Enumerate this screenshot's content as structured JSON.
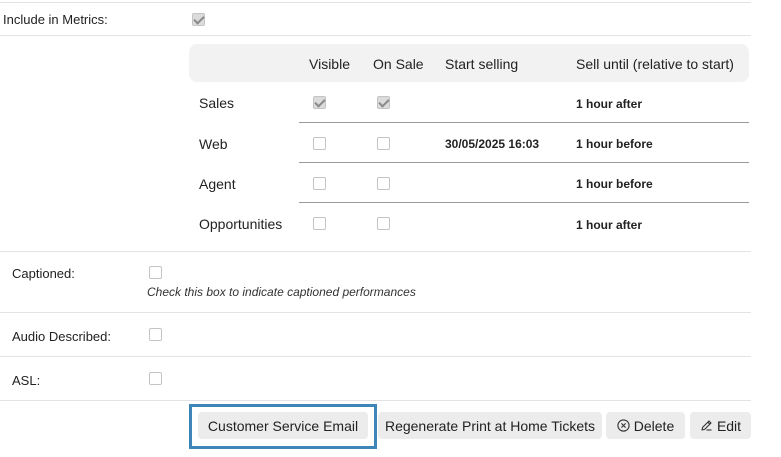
{
  "include_metrics": {
    "label": "Include in Metrics:",
    "checked": true
  },
  "table": {
    "headers": [
      "Visible",
      "On Sale",
      "Start selling",
      "Sell until (relative to start)"
    ],
    "rows": [
      {
        "name": "Sales",
        "visible": true,
        "on_sale": true,
        "start": "",
        "until": "1 hour after"
      },
      {
        "name": "Web",
        "visible": false,
        "on_sale": false,
        "start": "30/05/2025 16:03",
        "until": "1 hour before"
      },
      {
        "name": "Agent",
        "visible": false,
        "on_sale": false,
        "start": "",
        "until": "1 hour before"
      },
      {
        "name": "Opportunities",
        "visible": false,
        "on_sale": false,
        "start": "",
        "until": "1 hour after"
      }
    ]
  },
  "captioned": {
    "label": "Captioned:",
    "hint": "Check this box to indicate captioned performances",
    "checked": false
  },
  "audio_described": {
    "label": "Audio Described:",
    "checked": false
  },
  "asl": {
    "label": "ASL:",
    "checked": false
  },
  "buttons": {
    "customer_service_email": "Customer Service Email",
    "regenerate": "Regenerate Print at Home Tickets",
    "delete": "Delete",
    "edit": "Edit"
  },
  "colors": {
    "highlight": "#3f86b8",
    "button_bg": "#ececec",
    "header_bg": "#f2f2f2"
  }
}
